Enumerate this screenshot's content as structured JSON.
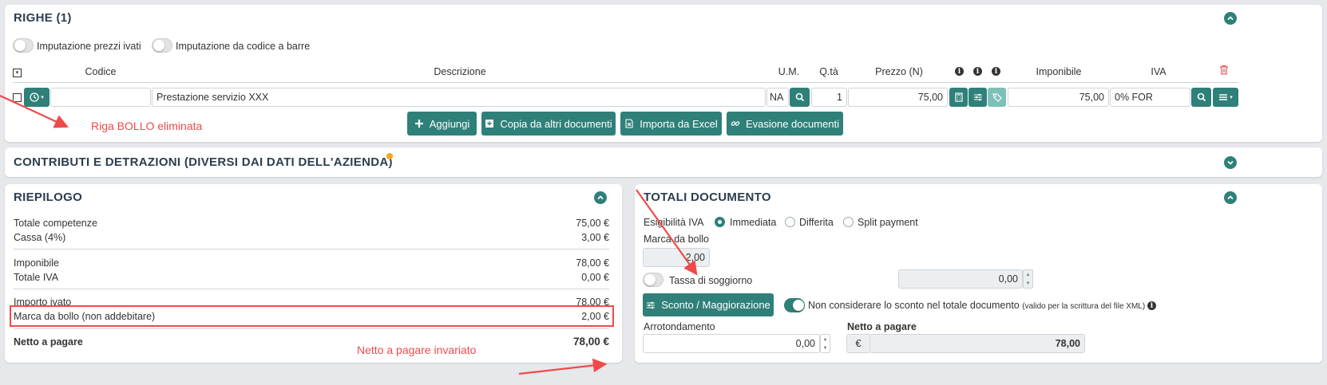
{
  "righe": {
    "title": "RIGHE (1)",
    "toggle_prezzi_ivati": "Imputazione prezzi ivati",
    "toggle_codice_barre": "Imputazione da codice a barre",
    "headers": {
      "codice": "Codice",
      "descrizione": "Descrizione",
      "um": "U.M.",
      "qta": "Q.tà",
      "prezzo": "Prezzo (N)",
      "imponibile": "Imponibile",
      "iva": "IVA"
    },
    "row": {
      "codice": "",
      "descrizione": "Prestazione servizio XXX",
      "um": "NA",
      "qta": "1",
      "prezzo": "75,00",
      "imponibile": "75,00",
      "iva": "0% FOR"
    },
    "buttons": {
      "aggiungi": "Aggiungi",
      "copia": "Copia da altri documenti",
      "importa": "Importa da Excel",
      "evasione": "Evasione documenti"
    }
  },
  "contributi": {
    "title": "CONTRIBUTI E DETRAZIONI (DIVERSI DAI DATI DELL'AZIENDA)"
  },
  "riepilogo": {
    "title": "RIEPILOGO",
    "totale_competenze_label": "Totale competenze",
    "totale_competenze_value": "75,00 €",
    "cassa_label": "Cassa (4%)",
    "cassa_value": "3,00 €",
    "imponibile_label": "Imponibile",
    "imponibile_value": "78,00 €",
    "totale_iva_label": "Totale IVA",
    "totale_iva_value": "0,00 €",
    "importo_ivato_label": "Importo ivato",
    "importo_ivato_value": "78,00 €",
    "marca_label": "Marca da bollo (non addebitare)",
    "marca_value": "2,00 €",
    "netto_label": "Netto a pagare",
    "netto_value": "78,00 €"
  },
  "totali": {
    "title": "TOTALI DOCUMENTO",
    "esigibilita_label": "Esigibilità IVA",
    "radio_immediata": "Immediata",
    "radio_differita": "Differita",
    "radio_split": "Split payment",
    "marca_label": "Marca da bollo",
    "marca_value": "2,00",
    "tassa_label": "Tassa di soggiorno",
    "tassa_value": "0,00",
    "sconto_button": "Sconto / Maggiorazione",
    "non_considerare_label": "Non considerare lo sconto nel totale documento",
    "non_considerare_note": "(valido per la scrittura del file XML)",
    "arrotondamento_label": "Arrotondamento",
    "arrotondamento_value": "0,00",
    "netto_label": "Netto a pagare",
    "netto_currency": "€",
    "netto_value": "78,00"
  },
  "annotations": {
    "riga_bollo": "Riga BOLLO eliminata",
    "netto_invariato": "Netto a pagare invariato"
  },
  "colors": {
    "accent": "#2f8079",
    "annotation_red": "#f04a4a"
  }
}
